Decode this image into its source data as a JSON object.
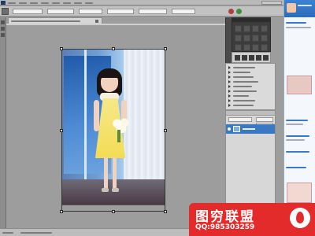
{
  "colors": {
    "app_chrome": "#b6b6b6",
    "canvas_bg": "#9d9d9d",
    "toolbar": "#3f3f3f",
    "panel_bg": "#d7d7d7",
    "layer_selected": "#3a78c3",
    "chat_blue": "#3978c8",
    "watermark_red": "#e32b2b"
  },
  "document_tab": {
    "title": ""
  },
  "options_bar": {
    "values": [
      "",
      "",
      "",
      "",
      "",
      ""
    ]
  },
  "tools_panel": {
    "icons": [
      "move-icon",
      "marquee-icon",
      "lasso-icon",
      "magic-wand-icon",
      "crop-icon",
      "eyedropper-icon",
      "healing-icon",
      "brush-icon",
      "stamp-icon",
      "history-brush-icon",
      "eraser-icon",
      "gradient-icon",
      "blur-icon",
      "dodge-icon",
      "pen-icon",
      "type-icon",
      "path-select-icon",
      "shape-icon",
      "hand-icon",
      "zoom-icon"
    ]
  },
  "actions_panel": {
    "items": [
      "",
      "",
      "",
      "",
      "",
      "",
      "",
      "",
      ""
    ]
  },
  "layers_panel": {
    "mode": "",
    "opacity": "",
    "fill": "",
    "layer_name": ""
  },
  "status_bar": {
    "zoom": "",
    "doc_info": ""
  },
  "chat_panel": {
    "username": "",
    "messages": [
      "",
      "",
      "",
      "",
      "",
      "",
      "",
      ""
    ]
  },
  "watermark": {
    "title": "图穷联盟",
    "qq": "QQ:985303259"
  }
}
